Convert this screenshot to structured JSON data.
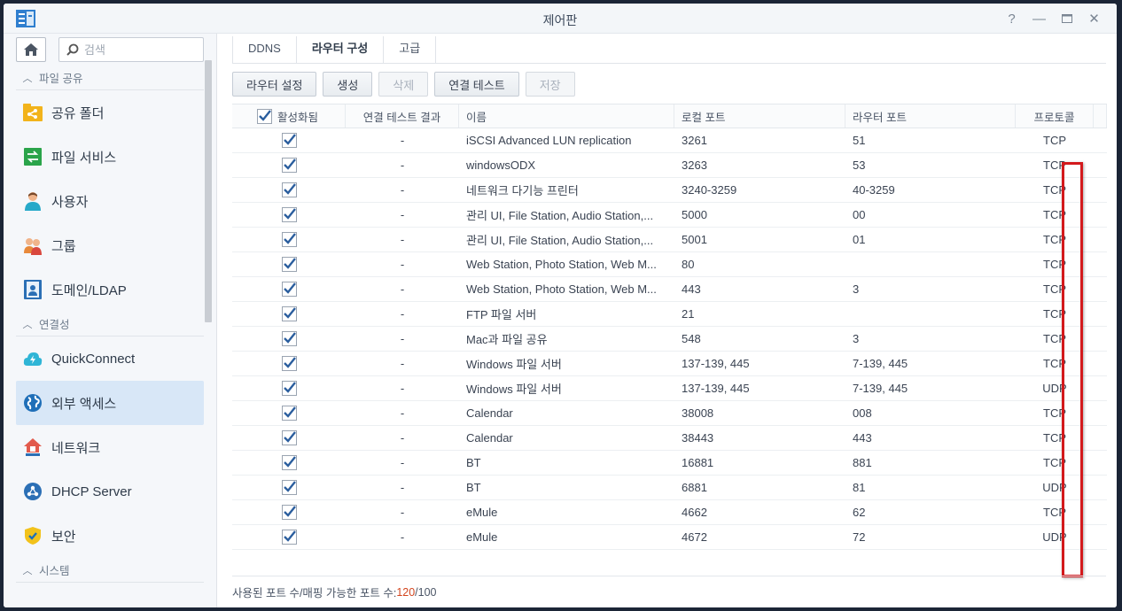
{
  "window": {
    "title": "제어판"
  },
  "search": {
    "placeholder": "검색"
  },
  "sidebar": {
    "sections": [
      {
        "label": "파일 공유"
      },
      {
        "label": "연결성"
      },
      {
        "label": "시스템"
      }
    ],
    "items": [
      {
        "label": "공유 폴더",
        "icon": "shared-folder-icon"
      },
      {
        "label": "파일 서비스",
        "icon": "file-services-icon"
      },
      {
        "label": "사용자",
        "icon": "user-icon"
      },
      {
        "label": "그룹",
        "icon": "group-icon"
      },
      {
        "label": "도메인/LDAP",
        "icon": "domain-icon"
      },
      {
        "label": "QuickConnect",
        "icon": "quickconnect-icon"
      },
      {
        "label": "외부 액세스",
        "icon": "globe-icon",
        "active": true
      },
      {
        "label": "네트워크",
        "icon": "network-icon"
      },
      {
        "label": "DHCP Server",
        "icon": "dhcp-icon"
      },
      {
        "label": "보안",
        "icon": "shield-icon"
      }
    ]
  },
  "tabs": [
    {
      "label": "DDNS"
    },
    {
      "label": "라우터 구성",
      "active": true
    },
    {
      "label": "고급"
    }
  ],
  "toolbar": {
    "router_settings": "라우터 설정",
    "create": "생성",
    "delete": "삭제",
    "connection_test": "연결 테스트",
    "save": "저장"
  },
  "table": {
    "headers": {
      "enabled": "활성화됨",
      "test_result": "연결 테스트 결과",
      "name": "이름",
      "local_port": "로컬 포트",
      "router_port": "라우터 포트",
      "protocol": "프로토콜"
    },
    "rows": [
      {
        "test": "-",
        "name": "iSCSI Advanced LUN replication",
        "local": "3261",
        "router": "51",
        "proto": "TCP"
      },
      {
        "test": "-",
        "name": "windowsODX",
        "local": "3263",
        "router": "53",
        "proto": "TCP"
      },
      {
        "test": "-",
        "name": "네트워크 다기능 프린터",
        "local": "3240-3259",
        "router": "40-3259",
        "proto": "TCP"
      },
      {
        "test": "-",
        "name": "관리 UI, File Station, Audio Station,...",
        "local": "5000",
        "router": "00",
        "proto": "TCP"
      },
      {
        "test": "-",
        "name": "관리 UI, File Station, Audio Station,...",
        "local": "5001",
        "router": "01",
        "proto": "TCP"
      },
      {
        "test": "-",
        "name": "Web Station, Photo Station, Web M...",
        "local": "80",
        "router": "",
        "proto": "TCP"
      },
      {
        "test": "-",
        "name": "Web Station, Photo Station, Web M...",
        "local": "443",
        "router": "3",
        "proto": "TCP"
      },
      {
        "test": "-",
        "name": "FTP 파일 서버",
        "local": "21",
        "router": "",
        "proto": "TCP"
      },
      {
        "test": "-",
        "name": "Mac과 파일 공유",
        "local": "548",
        "router": "3",
        "proto": "TCP"
      },
      {
        "test": "-",
        "name": "Windows 파일 서버",
        "local": "137-139, 445",
        "router": "7-139, 445",
        "proto": "TCP"
      },
      {
        "test": "-",
        "name": "Windows 파일 서버",
        "local": "137-139, 445",
        "router": "7-139, 445",
        "proto": "UDP"
      },
      {
        "test": "-",
        "name": "Calendar",
        "local": "38008",
        "router": "008",
        "proto": "TCP"
      },
      {
        "test": "-",
        "name": "Calendar",
        "local": "38443",
        "router": "443",
        "proto": "TCP"
      },
      {
        "test": "-",
        "name": "BT",
        "local": "16881",
        "router": "881",
        "proto": "TCP"
      },
      {
        "test": "-",
        "name": "BT",
        "local": "6881",
        "router": "81",
        "proto": "UDP"
      },
      {
        "test": "-",
        "name": "eMule",
        "local": "4662",
        "router": "62",
        "proto": "TCP"
      },
      {
        "test": "-",
        "name": "eMule",
        "local": "4672",
        "router": "72",
        "proto": "UDP"
      }
    ]
  },
  "footer": {
    "label": "사용된 포트 수/매핑 가능한 포트 수: ",
    "used": "120",
    "separator": "/",
    "total": "100"
  },
  "colors": {
    "accent": "#d8e7f7",
    "highlight": "#d3191c",
    "check": "#2b5e9e"
  }
}
